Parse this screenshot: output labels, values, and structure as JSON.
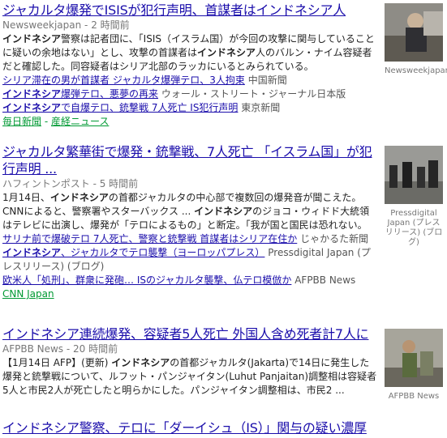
{
  "stories": [
    {
      "headline": "ジャカルタ爆発でISISが犯行声明、首謀者はインドネシア人",
      "source": "Newsweekjapan",
      "time": "2 時間前",
      "snippet_html": "<b>インドネシア</b>警察は記者団に、「ISIS（イスラム国）が今回の攻撃に関与していることに疑いの余地はない」とし、攻撃の首謀者は<b>インドネシア</b>人のバルン・ナイム容疑者だと確認した。同容疑者はシリア北部のラッカにいるとみられている。",
      "related": [
        {
          "link_html": "シリア滞在の男が首謀者 ジャカルタ爆弾テロ、3人拘束",
          "src": "中国新聞"
        },
        {
          "link_html": "<b>インドネシア</b>爆弾テロ、悪夢の再来",
          "src": "ウォール・ストリート・ジャーナル日本版"
        },
        {
          "link_html": "<b>インドネシア</b>で自爆テロ、銃撃戦 7人死亡 IS犯行声明",
          "src": "東京新聞"
        }
      ],
      "more": [
        "毎日新聞",
        "産経ニュース"
      ],
      "thumb_caption": "Newsweekjapan"
    },
    {
      "headline": "ジャカルタ繁華街で爆発・銃撃戦、7人死亡 「イスラム国」が犯行声明 ...",
      "source": "ハフィントンポスト",
      "time": "5 時間前",
      "snippet_html": "1月14日、<b>インドネシア</b>の首都ジャカルタの中心部で複数回の爆発音が聞こえた。CNNによると、警察署やスターバックス ... <b>インドネシア</b>のジョコ・ウィドド大統領はテレビに出演し、爆発が「テロによるもの」と断定。「我が国と国民は恐れない。",
      "related": [
        {
          "link_html": "サリナ前で爆破テロ 7人死亡、警察と銃撃戦 首謀者はシリア在住か",
          "src": "じゃかるた新聞"
        },
        {
          "link_html": "<b>インドネシア</b>、ジャカルタでテロ襲撃（ヨーロッパプレス）",
          "src": "Pressdigital Japan (プレスリリース) (ブログ)"
        },
        {
          "link_html": "欧米人「処刑」、群衆に発砲… ISのジャカルタ襲撃、仏テロ模倣か",
          "src": "AFPBB News"
        }
      ],
      "more": [
        "CNN Japan"
      ],
      "thumb_caption": "Pressdigital Japan (プレスリリース) (ブログ)"
    },
    {
      "headline": "インドネシア連続爆発、容疑者5人死亡 外国人含め死者計7人に",
      "source": "AFPBB News",
      "time": "20 時間前",
      "snippet_html": "【1月14日 AFP】(更新) <b>インドネシア</b>の首都ジャカルタ(Jakarta)で14日に発生した爆発と銃撃戦について、ルフット・パンジャイタン(Luhut Panjaitan)調整相は容疑者5人と市民2人が死亡したと明らかにした。パンジャイタン調整相は、市民2 ...",
      "related": [],
      "more": [],
      "thumb_caption": "AFPBB News"
    },
    {
      "headline": "インドネシア警察、テロに「ダーイシュ（IS）」関与の疑い濃厚",
      "source": "",
      "time": "",
      "snippet_html": "",
      "related": [],
      "more": [],
      "thumb_caption": ""
    }
  ]
}
